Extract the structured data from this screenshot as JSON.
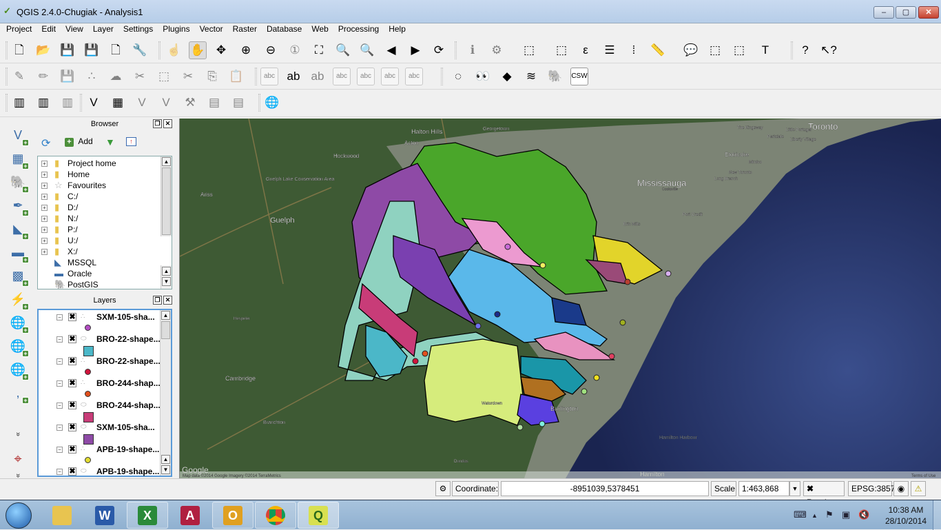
{
  "window": {
    "title": "QGIS 2.4.0-Chugiak - Analysis1",
    "min": "–",
    "max": "▢",
    "close": "✕"
  },
  "menu": [
    "Project",
    "Edit",
    "View",
    "Layer",
    "Settings",
    "Plugins",
    "Vector",
    "Raster",
    "Database",
    "Web",
    "Processing",
    "Help"
  ],
  "toolbar1": [
    {
      "name": "new-project-icon",
      "glyph": "🗋"
    },
    {
      "name": "open-project-icon",
      "glyph": "📂"
    },
    {
      "name": "save-project-icon",
      "glyph": "💾"
    },
    {
      "name": "save-as-icon",
      "glyph": "💾"
    },
    {
      "name": "new-print-composer-icon",
      "glyph": "🗋"
    },
    {
      "name": "composer-manager-icon",
      "glyph": "🔧"
    },
    {
      "name": "touch-zoom-pan-icon",
      "glyph": "☝"
    },
    {
      "name": "pan-map-icon",
      "glyph": "✋"
    },
    {
      "name": "pan-to-selection-icon",
      "glyph": "✥"
    },
    {
      "name": "zoom-in-icon",
      "glyph": "⊕"
    },
    {
      "name": "zoom-out-icon",
      "glyph": "⊖"
    },
    {
      "name": "zoom-native-icon",
      "glyph": "①"
    },
    {
      "name": "zoom-full-icon",
      "glyph": "⛶"
    },
    {
      "name": "zoom-selection-icon",
      "glyph": "🔍"
    },
    {
      "name": "zoom-layer-icon",
      "glyph": "🔍"
    },
    {
      "name": "zoom-last-icon",
      "glyph": "◀"
    },
    {
      "name": "zoom-next-icon",
      "glyph": "▶"
    },
    {
      "name": "refresh-icon",
      "glyph": "⟳"
    },
    {
      "name": "identify-icon",
      "glyph": "ℹ"
    },
    {
      "name": "run-action-icon",
      "glyph": "⚙"
    },
    {
      "name": "select-features-icon",
      "glyph": "⬚"
    },
    {
      "name": "deselect-icon",
      "glyph": "⬚"
    },
    {
      "name": "select-expression-icon",
      "glyph": "ε"
    },
    {
      "name": "attribute-table-icon",
      "glyph": "☰"
    },
    {
      "name": "statistics-icon",
      "glyph": "⁞"
    },
    {
      "name": "measure-icon",
      "glyph": "📏"
    },
    {
      "name": "map-tips-icon",
      "glyph": "💬"
    },
    {
      "name": "new-bookmark-icon",
      "glyph": "⬚"
    },
    {
      "name": "show-bookmarks-icon",
      "glyph": "⬚"
    },
    {
      "name": "text-annotation-icon",
      "glyph": "T"
    },
    {
      "name": "help-contents-icon",
      "glyph": "?"
    },
    {
      "name": "whats-this-icon",
      "glyph": "↖?"
    }
  ],
  "toolbar2": [
    {
      "name": "current-edits-icon",
      "glyph": "✎"
    },
    {
      "name": "toggle-editing-icon",
      "glyph": "✏"
    },
    {
      "name": "save-edits-icon",
      "glyph": "💾"
    },
    {
      "name": "add-point-icon",
      "glyph": "∴"
    },
    {
      "name": "move-feature-icon",
      "glyph": "☁"
    },
    {
      "name": "node-tool-icon",
      "glyph": "✂"
    },
    {
      "name": "delete-selected-icon",
      "glyph": "⬚"
    },
    {
      "name": "cut-features-icon",
      "glyph": "✂"
    },
    {
      "name": "copy-features-icon",
      "glyph": "⎘"
    },
    {
      "name": "paste-features-icon",
      "glyph": "📋"
    },
    {
      "name": "label-tool-icon",
      "glyph": "abc"
    },
    {
      "name": "highlight-labels-icon",
      "glyph": "ab"
    },
    {
      "name": "pin-labels-icon",
      "glyph": "ab"
    },
    {
      "name": "show-hide-labels-icon",
      "glyph": "abc"
    },
    {
      "name": "move-label-icon",
      "glyph": "abc"
    },
    {
      "name": "rotate-label-icon",
      "glyph": "abc"
    },
    {
      "name": "change-label-icon",
      "glyph": "abc"
    },
    {
      "name": "georeferencer-icon",
      "glyph": "◌"
    },
    {
      "name": "search-binoculars-icon",
      "glyph": "👀"
    },
    {
      "name": "africa-map-icon",
      "glyph": "◆"
    },
    {
      "name": "spatial-query-icon",
      "glyph": "≋"
    },
    {
      "name": "postgis-plugin-icon",
      "glyph": "🐘"
    },
    {
      "name": "csw-icon",
      "glyph": "CSW"
    }
  ],
  "toolbar3": [
    {
      "name": "db-import-icon",
      "glyph": "▥"
    },
    {
      "name": "db-add-icon",
      "glyph": "▥"
    },
    {
      "name": "db-remove-icon",
      "glyph": "▥"
    },
    {
      "name": "new-shapefile-icon",
      "glyph": "V"
    },
    {
      "name": "new-raster-icon",
      "glyph": "▦"
    },
    {
      "name": "new-vector-icon",
      "glyph": "V"
    },
    {
      "name": "edit-vector-icon",
      "glyph": "V"
    },
    {
      "name": "tools-icon",
      "glyph": "⚒"
    },
    {
      "name": "grid-icon",
      "glyph": "▤"
    },
    {
      "name": "grid-edit-icon",
      "glyph": "▤"
    },
    {
      "name": "google-earth-icon",
      "glyph": "🌐"
    }
  ],
  "leftbar": [
    {
      "name": "add-vector-layer-icon",
      "glyph": "V"
    },
    {
      "name": "add-raster-layer-icon",
      "glyph": "▦"
    },
    {
      "name": "add-postgis-layer-icon",
      "glyph": "🐘"
    },
    {
      "name": "add-spatialite-layer-icon",
      "glyph": "✒"
    },
    {
      "name": "add-mssql-layer-icon",
      "glyph": "◣"
    },
    {
      "name": "add-oracle-layer-icon",
      "glyph": "▬"
    },
    {
      "name": "add-oracle-georaster-icon",
      "glyph": "▩"
    },
    {
      "name": "add-wms-layer-icon",
      "glyph": "⚡"
    },
    {
      "name": "add-wcs-layer-icon",
      "glyph": "🌐"
    },
    {
      "name": "add-wfs-layer-icon",
      "glyph": "🌐"
    },
    {
      "name": "add-wmts-layer-icon",
      "glyph": "🌐"
    },
    {
      "name": "add-delimited-text-icon",
      "glyph": ","
    }
  ],
  "browser": {
    "title": "Browser",
    "add_label": "Add",
    "items": [
      {
        "label": "Project home",
        "icon": "folder",
        "expandable": true
      },
      {
        "label": "Home",
        "icon": "folder",
        "expandable": true
      },
      {
        "label": "Favourites",
        "icon": "star",
        "expandable": true
      },
      {
        "label": "C:/",
        "icon": "folder",
        "expandable": true
      },
      {
        "label": "D:/",
        "icon": "folder",
        "expandable": true
      },
      {
        "label": "N:/",
        "icon": "folder",
        "expandable": true
      },
      {
        "label": "P:/",
        "icon": "folder",
        "expandable": true
      },
      {
        "label": "U:/",
        "icon": "folder",
        "expandable": true
      },
      {
        "label": "X:/",
        "icon": "folder",
        "expandable": true
      },
      {
        "label": "MSSQL",
        "icon": "mssql",
        "expandable": false
      },
      {
        "label": "Oracle",
        "icon": "oracle",
        "expandable": false
      },
      {
        "label": "PostGIS",
        "icon": "postgis",
        "expandable": false
      }
    ]
  },
  "layers": {
    "title": "Layers",
    "items": [
      {
        "label": "SXM-105-sha...",
        "type": "point",
        "color": "#b44ec4",
        "visible": true
      },
      {
        "label": "BRO-22-shape...",
        "type": "polygon",
        "color": "#4bb7c8",
        "visible": true
      },
      {
        "label": "BRO-22-shape...",
        "type": "point",
        "color": "#d0143c",
        "visible": true
      },
      {
        "label": "BRO-244-shap...",
        "type": "point",
        "color": "#e2501e",
        "visible": true
      },
      {
        "label": "BRO-244-shap...",
        "type": "polygon",
        "color": "#c83c78",
        "visible": true
      },
      {
        "label": "SXM-105-sha...",
        "type": "polygon",
        "color": "#8e4aa6",
        "visible": true
      },
      {
        "label": "APB-19-shape...",
        "type": "point",
        "color": "#e2dc32",
        "visible": true
      },
      {
        "label": "APB-19-shape...",
        "type": "polygon",
        "color": "#5a8c78",
        "visible": true
      }
    ]
  },
  "map": {
    "labels": [
      "Halton Hills",
      "Georgetown",
      "Acton",
      "Hockwood",
      "Guelph Lake Conservation Area",
      "Ariss",
      "Guelph",
      "Mississauga",
      "Erin Mills",
      "Port Credit",
      "Toronto",
      "Etobicoke",
      "Mimico",
      "New Toronto",
      "Long Branch",
      "The Kingsway",
      "Little Portugal",
      "Parkdale",
      "Liberty Village",
      "Hespeler",
      "Cambridge",
      "Branchton",
      "Waterdown",
      "Dundas",
      "Hamilton Harbour",
      "Hamilton",
      "Burlington",
      "Cooksville"
    ],
    "attribution": "Map data ©2014 Google Imagery ©2014 TerraMetrics",
    "google_logo": "Google",
    "terms": "Terms of Use"
  },
  "status": {
    "coordinate_label": "Coordinate:",
    "coordinate_value": "-8951039,5378451",
    "scale_label": "Scale",
    "scale_value": "1:463,868",
    "render_label": "Render",
    "render_checked": true,
    "crs": "EPSG:3857"
  },
  "taskbar": {
    "apps": [
      {
        "name": "start-button",
        "label": "Start"
      },
      {
        "name": "explorer",
        "label": "Explorer"
      },
      {
        "name": "word",
        "label": "W"
      },
      {
        "name": "excel",
        "label": "X"
      },
      {
        "name": "access",
        "label": "A"
      },
      {
        "name": "outlook",
        "label": "O"
      },
      {
        "name": "chrome",
        "label": "Chrome"
      },
      {
        "name": "qgis",
        "label": "Q"
      }
    ],
    "time": "10:38 AM",
    "date": "28/10/2014"
  }
}
